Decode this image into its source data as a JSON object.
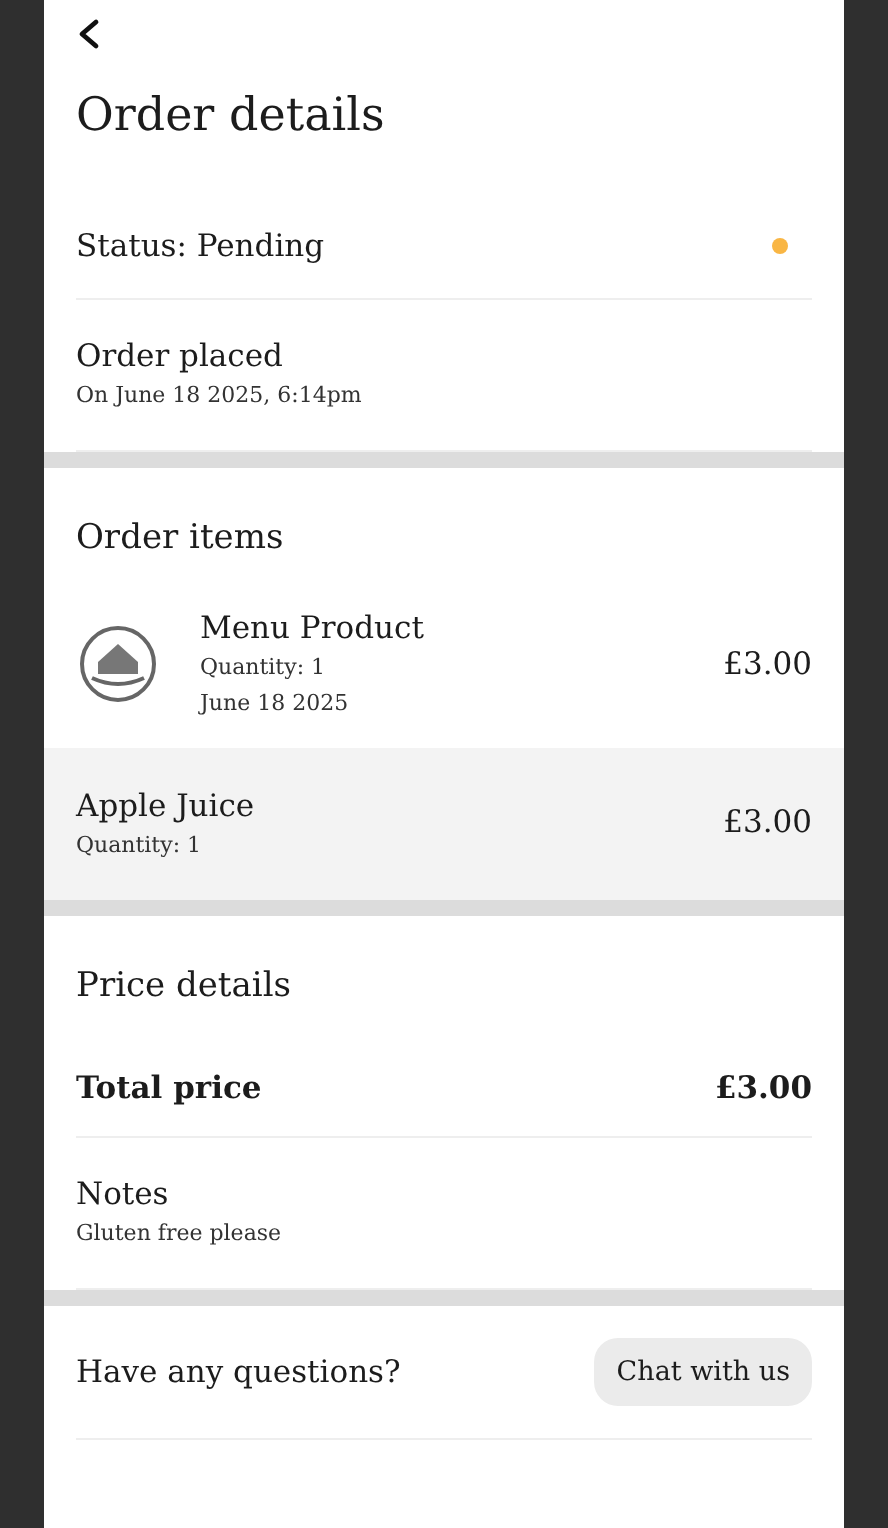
{
  "header": {
    "title": "Order details"
  },
  "status": {
    "label": "Status: Pending",
    "color": "#f9b644"
  },
  "placed": {
    "label": "Order placed",
    "date": "On June 18 2025, 6:14pm"
  },
  "order_items": {
    "title": "Order items",
    "items": [
      {
        "kind": "with_image",
        "name": "Menu Product",
        "quantity": "Quantity: 1",
        "date": "June 18 2025",
        "price": "£3.00",
        "selected": false
      },
      {
        "kind": "plain",
        "name": "Apple Juice",
        "quantity": "Quantity: 1",
        "price": "£3.00",
        "selected": true
      }
    ]
  },
  "price_details": {
    "title": "Price details",
    "total_label": "Total price",
    "total": "£3.00"
  },
  "notes": {
    "label": "Notes",
    "text": "Gluten free please"
  },
  "help": {
    "question": "Have any questions?",
    "button": "Chat with us"
  }
}
